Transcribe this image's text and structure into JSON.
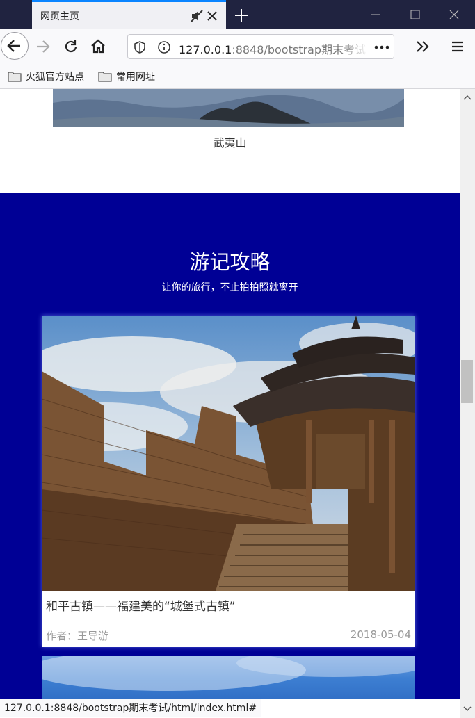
{
  "browser": {
    "tab_title": "网页主页",
    "url_host": "127.0.0.1",
    "url_path": ":8848/bootstrap期末考试",
    "bookmarks": [
      "火狐官方站点",
      "常用网址"
    ],
    "status_url": "127.0.0.1:8848/bootstrap期末考试/html/index.html#"
  },
  "top_section": {
    "caption": "武夷山"
  },
  "travel": {
    "title": "游记攻略",
    "subtitle": "让你的旅行，不止拍拍照就离开",
    "cards": [
      {
        "title": "和平古镇——福建美的“城堡式古镇”",
        "author": "作者：王导游",
        "date": "2018-05-04"
      }
    ]
  },
  "colors": {
    "section_bg": "#000095",
    "titlebar_bg": "#202340",
    "tab_accent": "#0a84ff"
  }
}
